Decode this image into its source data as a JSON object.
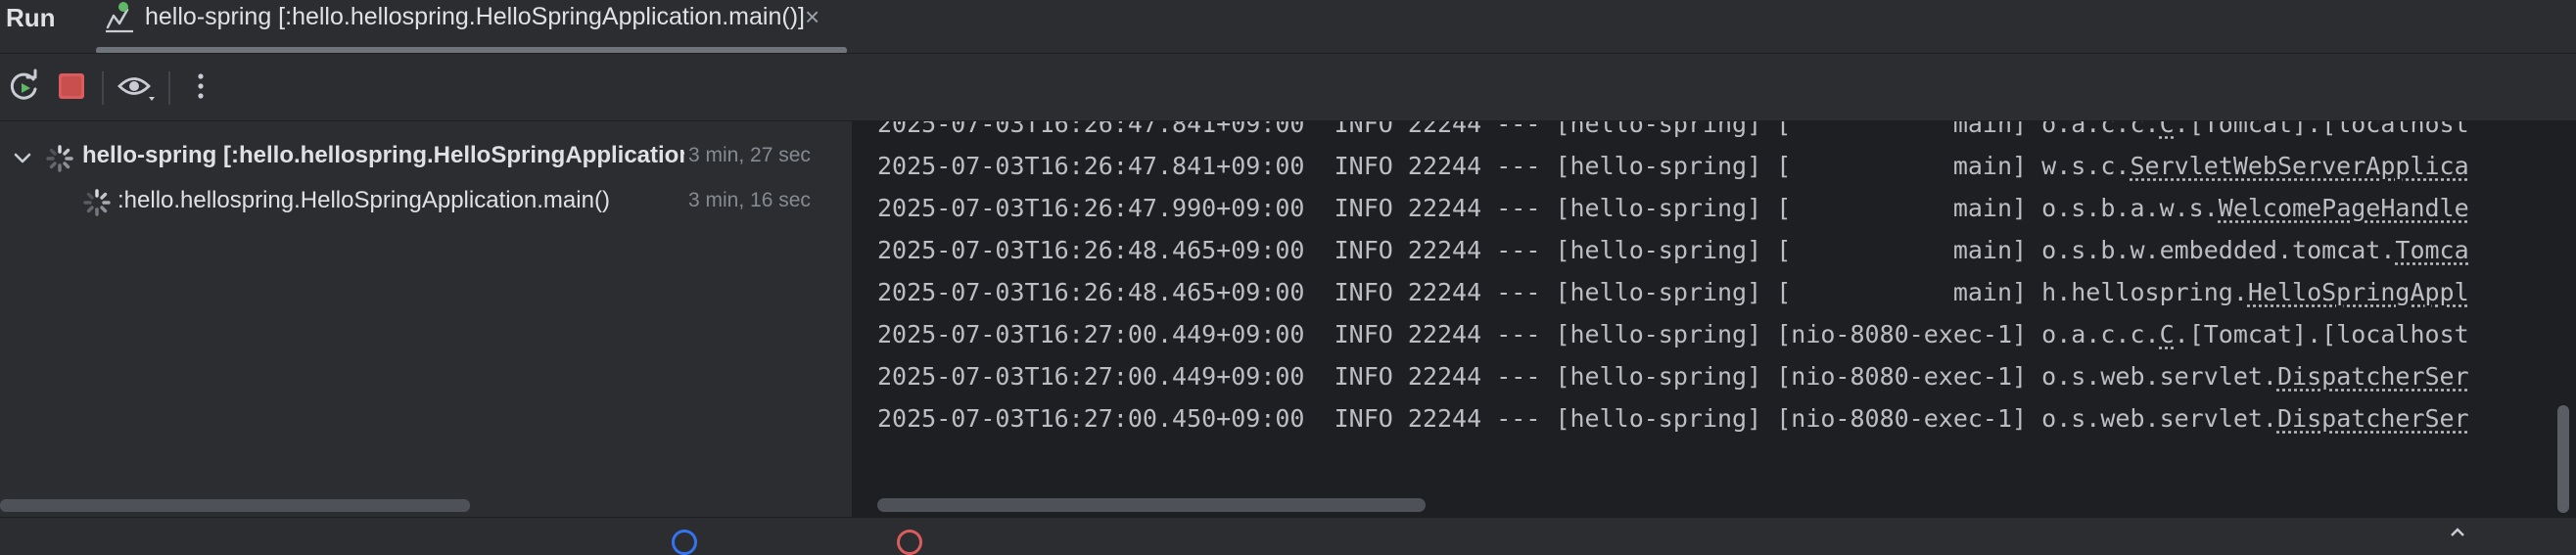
{
  "panel": {
    "title": "Run"
  },
  "tab": {
    "label": "hello-spring [:hello.hellospring.HelloSpringApplication.main()]",
    "close_glyph": "×",
    "icon": "run-config-icon",
    "status_dot_color": "#5fb865"
  },
  "toolbar": {
    "rerun_icon": "rerun-icon",
    "stop_icon": "stop-icon",
    "view_icon": "eye-icon",
    "more_icon": "more-vertical-icon"
  },
  "tree": {
    "items": [
      {
        "label": "hello-spring [:hello.hellospring.HelloSpringApplication",
        "time": "3 min, 27 sec",
        "expanded": true,
        "icon": "spinner-icon"
      },
      {
        "label": ":hello.hellospring.HelloSpringApplication.main()",
        "time": "3 min, 16 sec",
        "icon": "spinner-icon"
      }
    ]
  },
  "console": {
    "lines": [
      {
        "ts": "2025-07-03T16:26:47.841+09:00",
        "level": "INFO",
        "pid": "22244",
        "sep": "---",
        "app": "[hello-spring]",
        "thread": "[           main]",
        "logger_prefix": "o.a.c.c.",
        "logger_link": "C",
        "logger_rest": ".[Tomcat].[localhost"
      },
      {
        "ts": "2025-07-03T16:26:47.841+09:00",
        "level": "INFO",
        "pid": "22244",
        "sep": "---",
        "app": "[hello-spring]",
        "thread": "[           main]",
        "logger_prefix": "w.s.c.",
        "logger_link": "ServletWebServerApplica",
        "logger_rest": ""
      },
      {
        "ts": "2025-07-03T16:26:47.990+09:00",
        "level": "INFO",
        "pid": "22244",
        "sep": "---",
        "app": "[hello-spring]",
        "thread": "[           main]",
        "logger_prefix": "o.s.b.a.w.s.",
        "logger_link": "WelcomePageHandle",
        "logger_rest": ""
      },
      {
        "ts": "2025-07-03T16:26:48.465+09:00",
        "level": "INFO",
        "pid": "22244",
        "sep": "---",
        "app": "[hello-spring]",
        "thread": "[           main]",
        "logger_prefix": "o.s.b.w.embedded.tomcat.",
        "logger_link": "Tomca",
        "logger_rest": ""
      },
      {
        "ts": "2025-07-03T16:26:48.465+09:00",
        "level": "INFO",
        "pid": "22244",
        "sep": "---",
        "app": "[hello-spring]",
        "thread": "[           main]",
        "logger_prefix": "h.hellospring.",
        "logger_link": "HelloSpringAppl",
        "logger_rest": ""
      },
      {
        "ts": "2025-07-03T16:27:00.449+09:00",
        "level": "INFO",
        "pid": "22244",
        "sep": "---",
        "app": "[hello-spring]",
        "thread": "[nio-8080-exec-1]",
        "logger_prefix": "o.a.c.c.",
        "logger_link": "C",
        "logger_rest": ".[Tomcat].[localhost"
      },
      {
        "ts": "2025-07-03T16:27:00.449+09:00",
        "level": "INFO",
        "pid": "22244",
        "sep": "---",
        "app": "[hello-spring]",
        "thread": "[nio-8080-exec-1]",
        "logger_prefix": "o.s.web.servlet.",
        "logger_link": "DispatcherSer",
        "logger_rest": ""
      },
      {
        "ts": "2025-07-03T16:27:00.450+09:00",
        "level": "INFO",
        "pid": "22244",
        "sep": "---",
        "app": "[hello-spring]",
        "thread": "[nio-8080-exec-1]",
        "logger_prefix": "o.s.web.servlet.",
        "logger_link": "DispatcherSer",
        "logger_rest": ""
      }
    ]
  },
  "colors": {
    "accent_green": "#5fb865",
    "stop_red": "#db5c5c",
    "info_blue": "#3574f0",
    "error_red": "#db5c5c"
  }
}
